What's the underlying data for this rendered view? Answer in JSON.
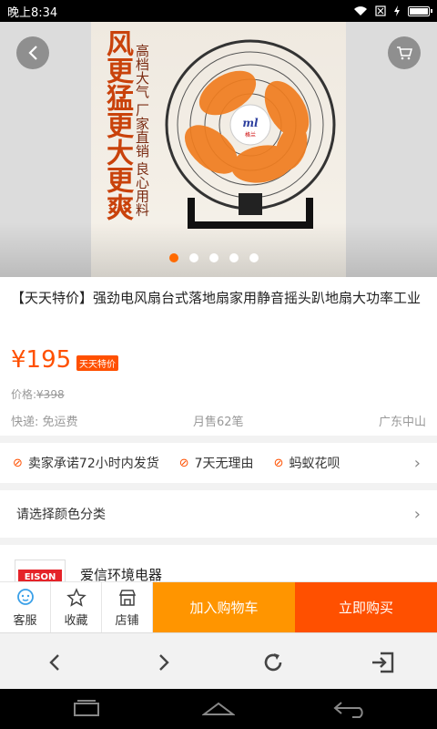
{
  "status_bar": {
    "time": "晚上8:34"
  },
  "gallery": {
    "slogan": "风更猛更大更爽",
    "tagline": "高档大气 厂家直销 良心用料",
    "brand_mark": "ml",
    "brand_sub": "格兰",
    "dots_count": 5,
    "active_dot": 1
  },
  "product": {
    "title": "【天天特价】强劲电风扇台式落地扇家用静音摇头趴地扇大功率工业",
    "price": "¥195",
    "badge": "天天特价",
    "original_price_label": "价格:",
    "original_price": "¥398",
    "shipping": "快递: 免运费",
    "monthly_sales": "月售62笔",
    "location": "广东中山"
  },
  "promises": [
    {
      "label": "卖家承诺72小时内发货"
    },
    {
      "label": "7天无理由"
    },
    {
      "label": "蚂蚁花呗"
    }
  ],
  "select_row": {
    "label": "请选择颜色分类"
  },
  "shop": {
    "name": "爱信环境电器",
    "logo_text": "EISON"
  },
  "action_bar": {
    "service": "客服",
    "favorite": "收藏",
    "store": "店铺",
    "add_to_cart": "加入购物车",
    "buy_now": "立即购买"
  },
  "colors": {
    "accent": "#ff5000",
    "cart": "#ff9500"
  }
}
